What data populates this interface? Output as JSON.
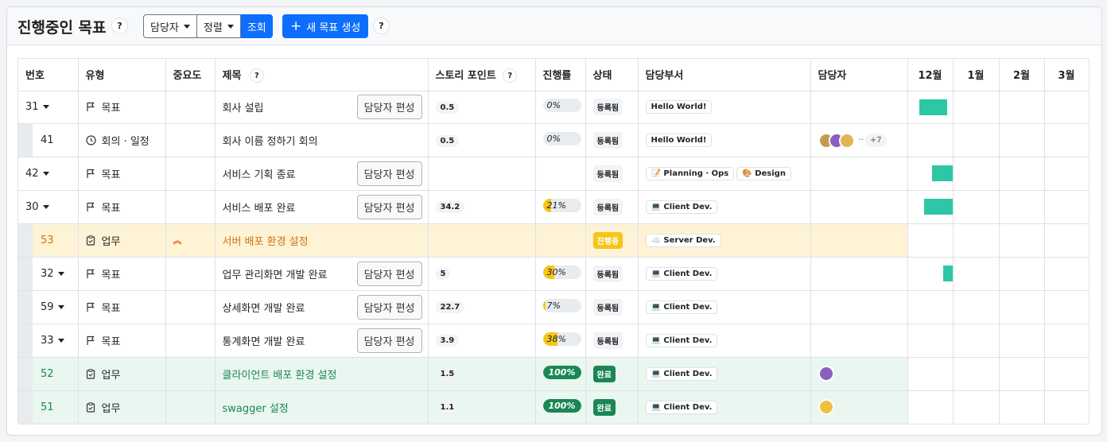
{
  "header": {
    "title": "진행중인 목표",
    "help": "?",
    "filter_assignee": "담당자",
    "filter_sort": "정렬",
    "search_label": "조회",
    "new_goal_label": "새 목표 생성",
    "new_goal_plus": "+"
  },
  "columns": {
    "num": "번호",
    "type": "유형",
    "priority": "중요도",
    "title": "제목",
    "title_help": "?",
    "story_points": "스토리 포인트",
    "sp_help": "?",
    "progress": "진행률",
    "status": "상태",
    "dept": "담당부서",
    "assignee": "담당자",
    "months": [
      "12월",
      "1월",
      "2월",
      "3월"
    ]
  },
  "edit_label": "담당자 편성",
  "colors": {
    "gantt": "#2ec7a6",
    "accent": "#0d6efd",
    "in_progress": "#f5c518",
    "done": "#198754"
  },
  "rows": [
    {
      "num": "31",
      "type": "목표",
      "icon": "flag-icon",
      "title": "회사 설립",
      "sp": "0.5",
      "progress": "0%",
      "status": "등록됨",
      "depts": [
        "Hello World!"
      ]
    },
    {
      "num": "41",
      "type": "회의 · 일정",
      "icon": "clock-icon",
      "title": "회사 이름 정하기 회의",
      "sp": "0.5",
      "progress": "0%",
      "status": "등록됨",
      "depts": [
        "Hello World!"
      ],
      "more": "··",
      "more_count": "+7"
    },
    {
      "num": "42",
      "type": "목표",
      "icon": "flag-icon",
      "title": "서비스 기획 종료",
      "status": "등록됨",
      "depts": [
        "📝 Planning · Ops",
        "🎨 Design"
      ]
    },
    {
      "num": "30",
      "type": "목표",
      "icon": "flag-icon",
      "title": "서비스 배포 완료",
      "sp": "34.2",
      "progress": "21%",
      "status": "등록됨",
      "depts": [
        "💻 Client Dev."
      ]
    },
    {
      "num": "53",
      "type": "업무",
      "icon": "clipboard-icon",
      "priority": "︽",
      "title": "서버 배포 환경 설정",
      "status": "진행중",
      "depts": [
        "☁️ Server Dev."
      ]
    },
    {
      "num": "32",
      "type": "목표",
      "icon": "flag-icon",
      "title": "업무 관리화면 개발 완료",
      "sp": "5",
      "progress": "30%",
      "status": "등록됨",
      "depts": [
        "💻 Client Dev."
      ]
    },
    {
      "num": "59",
      "type": "목표",
      "icon": "flag-icon",
      "title": "상세화면 개발 완료",
      "sp": "22.7",
      "progress": "7%",
      "status": "등록됨",
      "depts": [
        "💻 Client Dev."
      ]
    },
    {
      "num": "33",
      "type": "목표",
      "icon": "flag-icon",
      "title": "통계화면 개발 완료",
      "sp": "3.9",
      "progress": "38%",
      "status": "등록됨",
      "depts": [
        "💻 Client Dev."
      ]
    },
    {
      "num": "52",
      "type": "업무",
      "icon": "clipboard-icon",
      "title": "클라이언트 배포 환경 설정",
      "sp": "1.5",
      "progress": "100%",
      "status": "완료",
      "depts": [
        "💻 Client Dev."
      ]
    },
    {
      "num": "51",
      "type": "업무",
      "icon": "clipboard-icon",
      "title": "swagger 설정",
      "sp": "1.1",
      "progress": "100%",
      "status": "완료",
      "depts": [
        "💻 Client Dev."
      ]
    }
  ]
}
